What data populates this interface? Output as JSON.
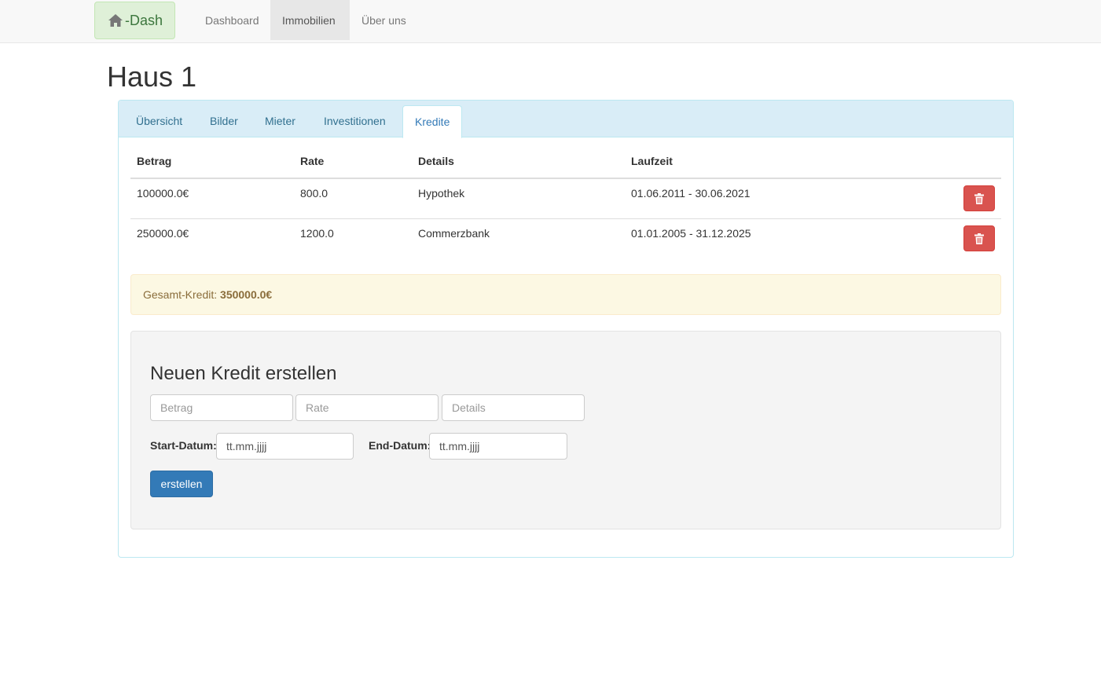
{
  "navbar": {
    "brand_label": "-Dash",
    "items": [
      {
        "label": "Dashboard"
      },
      {
        "label": "Immobilien",
        "active": true
      },
      {
        "label": "Über uns"
      }
    ]
  },
  "page": {
    "title": "Haus 1"
  },
  "tabs": [
    {
      "label": "Übersicht"
    },
    {
      "label": "Bilder"
    },
    {
      "label": "Mieter"
    },
    {
      "label": "Investitionen"
    },
    {
      "label": "Kredite",
      "active": true
    }
  ],
  "table": {
    "headers": [
      "Betrag",
      "Rate",
      "Details",
      "Laufzeit"
    ],
    "rows": [
      {
        "betrag": "100000.0€",
        "rate": "800.0",
        "details": "Hypothek",
        "laufzeit": "01.06.2011 - 30.06.2021"
      },
      {
        "betrag": "250000.0€",
        "rate": "1200.0",
        "details": "Commerzbank",
        "laufzeit": "01.01.2005 - 31.12.2025"
      }
    ],
    "delete_icon": "trash-icon"
  },
  "summary": {
    "label": "Gesamt-Kredit:",
    "value": "350000.0€"
  },
  "form": {
    "title": "Neuen Kredit erstellen",
    "betrag_placeholder": "Betrag",
    "rate_placeholder": "Rate",
    "details_placeholder": "Details",
    "start_label": "Start-Datum:",
    "start_value": "tt.mm.jjjj",
    "end_label": "End-Datum:",
    "end_value": "tt.mm.jjjj",
    "submit_label": "erstellen"
  },
  "colors": {
    "brand_bg": "#dff0d8",
    "panel_heading_bg": "#d9edf7",
    "danger": "#d9534f",
    "primary": "#337ab7",
    "alert_bg": "#fcf8e3"
  }
}
